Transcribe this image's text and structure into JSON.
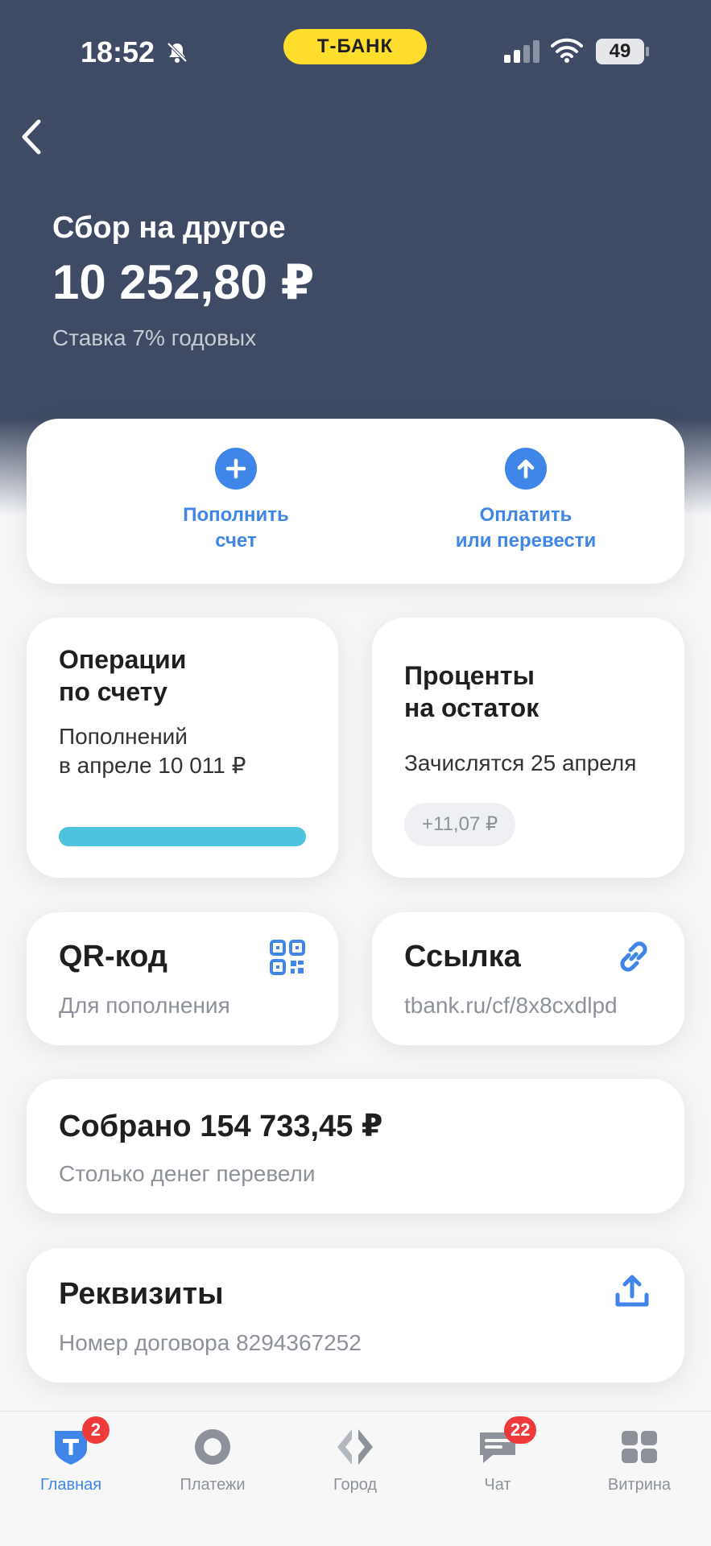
{
  "status_bar": {
    "time": "18:52",
    "bank_name": "Т-БАНК",
    "battery": "49"
  },
  "header": {
    "title": "Сбор на другое",
    "balance": "10 252,80 ₽",
    "rate": "Ставка 7% годовых"
  },
  "actions": {
    "topup_label": "Пополнить\nсчет",
    "pay_label": "Оплатить\nили перевести"
  },
  "operations": {
    "title": "Операции\nпо счету",
    "text": "Пополнений\nв апреле 10 011 ₽",
    "progress_fraction": 1.0
  },
  "interest": {
    "title": "Проценты\nна остаток",
    "text": "Зачислятся 25 апреля",
    "amount": "+11,07 ₽"
  },
  "qr": {
    "title": "QR-код",
    "subtitle": "Для пополнения"
  },
  "link": {
    "title": "Ссылка",
    "subtitle": "tbank.ru/cf/8x8cxdlpd"
  },
  "collected": {
    "title": "Собрано 154 733,45 ₽",
    "subtitle": "Столько денег перевели"
  },
  "details": {
    "title": "Реквизиты",
    "subtitle": "Номер договора 8294367252"
  },
  "tabbar": {
    "items": [
      {
        "label": "Главная",
        "icon": "shield-t-icon",
        "badge": "2"
      },
      {
        "label": "Платежи",
        "icon": "payments-circle-icon",
        "badge": ""
      },
      {
        "label": "Город",
        "icon": "city-diamond-icon",
        "badge": ""
      },
      {
        "label": "Чат",
        "icon": "chat-icon",
        "badge": "22"
      },
      {
        "label": "Витрина",
        "icon": "showcase-grid-icon",
        "badge": ""
      }
    ]
  },
  "colors": {
    "header": "#3f4b64",
    "accent": "#3f86e8",
    "brand_yellow": "#ffdd2d",
    "progress": "#4fc3dd",
    "badge": "#ef3a3a"
  }
}
